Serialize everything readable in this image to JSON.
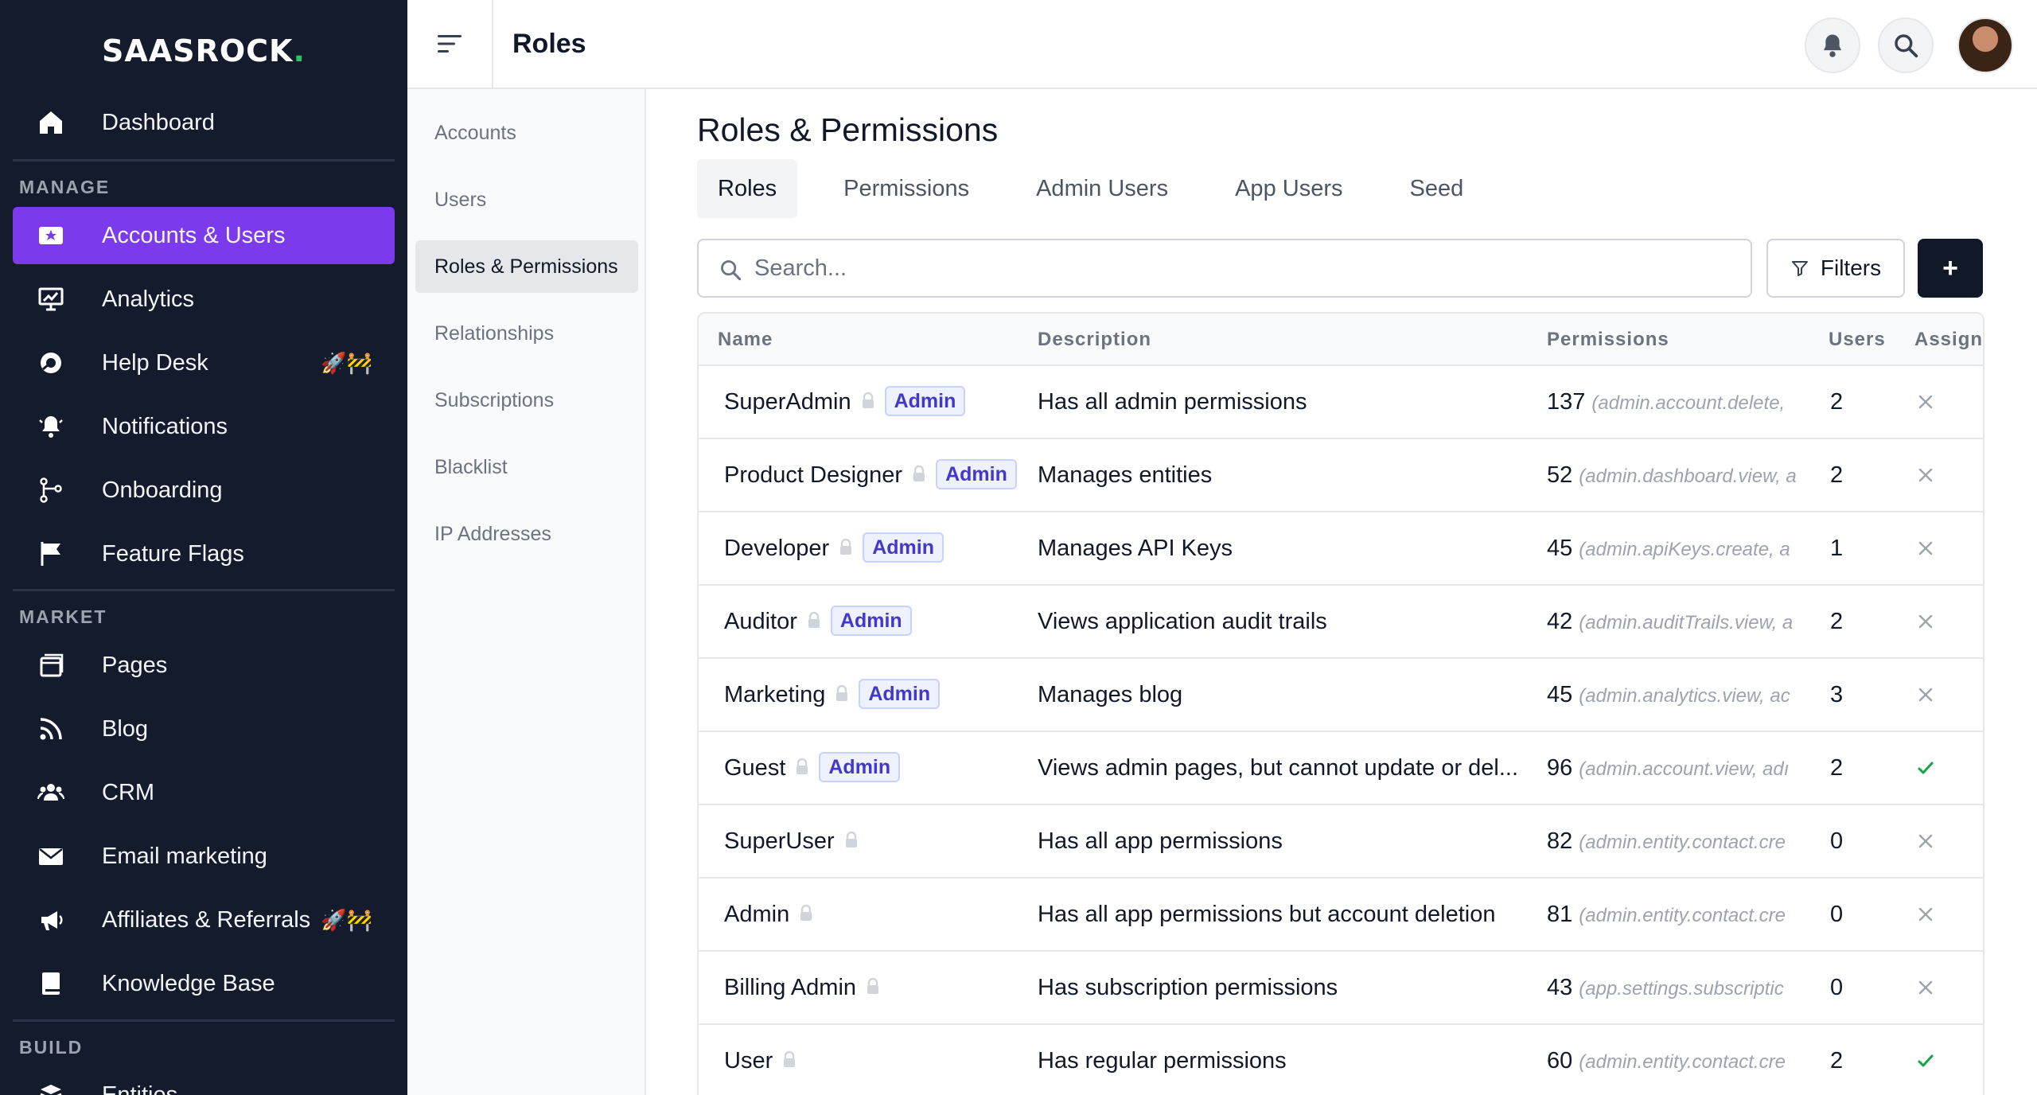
{
  "brand": {
    "name": "SAASROCK",
    "dot": "."
  },
  "sidebar": {
    "dashboard": {
      "label": "Dashboard",
      "icon": "home-icon"
    },
    "sections": [
      {
        "title": "MANAGE",
        "items": [
          {
            "label": "Accounts & Users",
            "icon": "accounts-icon",
            "active": true,
            "emoji": ""
          },
          {
            "label": "Analytics",
            "icon": "analytics-icon",
            "active": false,
            "emoji": ""
          },
          {
            "label": "Help Desk",
            "icon": "help-desk-icon",
            "active": false,
            "emoji": "🚀🚧"
          },
          {
            "label": "Notifications",
            "icon": "notifications-icon",
            "active": false,
            "emoji": ""
          },
          {
            "label": "Onboarding",
            "icon": "onboarding-icon",
            "active": false,
            "emoji": ""
          },
          {
            "label": "Feature Flags",
            "icon": "flag-icon",
            "active": false,
            "emoji": ""
          }
        ]
      },
      {
        "title": "MARKET",
        "items": [
          {
            "label": "Pages",
            "icon": "pages-icon",
            "active": false,
            "emoji": ""
          },
          {
            "label": "Blog",
            "icon": "rss-icon",
            "active": false,
            "emoji": ""
          },
          {
            "label": "CRM",
            "icon": "crm-icon",
            "active": false,
            "emoji": ""
          },
          {
            "label": "Email marketing",
            "icon": "email-icon",
            "active": false,
            "emoji": ""
          },
          {
            "label": "Affiliates & Referrals",
            "icon": "affiliates-icon",
            "active": false,
            "emoji": "🚀🚧"
          },
          {
            "label": "Knowledge Base",
            "icon": "book-icon",
            "active": false,
            "emoji": ""
          }
        ]
      },
      {
        "title": "BUILD",
        "items": [
          {
            "label": "Entities",
            "icon": "entities-icon",
            "active": false,
            "emoji": ""
          }
        ]
      }
    ]
  },
  "header": {
    "title": "Roles"
  },
  "subnav": [
    {
      "label": "Accounts",
      "active": false
    },
    {
      "label": "Users",
      "active": false
    },
    {
      "label": "Roles & Permissions",
      "active": true
    },
    {
      "label": "Relationships",
      "active": false
    },
    {
      "label": "Subscriptions",
      "active": false
    },
    {
      "label": "Blacklist",
      "active": false
    },
    {
      "label": "IP Addresses",
      "active": false
    }
  ],
  "main": {
    "title": "Roles & Permissions",
    "tabs": [
      {
        "label": "Roles",
        "active": true
      },
      {
        "label": "Permissions",
        "active": false
      },
      {
        "label": "Admin Users",
        "active": false
      },
      {
        "label": "App Users",
        "active": false
      },
      {
        "label": "Seed",
        "active": false
      }
    ],
    "search": {
      "placeholder": "Search...",
      "value": ""
    },
    "filters_label": "Filters",
    "add_label": "+"
  },
  "table": {
    "columns": [
      "Name",
      "Description",
      "Permissions",
      "Users",
      "Assign"
    ],
    "rows": [
      {
        "name": "SuperAdmin",
        "badge": "Admin",
        "description": "Has all admin permissions",
        "perm_count": "137",
        "perm_list": "(admin.account.delete,",
        "users": "2",
        "assigned": false
      },
      {
        "name": "Product Designer",
        "badge": "Admin",
        "description": "Manages entities",
        "perm_count": "52",
        "perm_list": "(admin.dashboard.view, a",
        "users": "2",
        "assigned": false
      },
      {
        "name": "Developer",
        "badge": "Admin",
        "description": "Manages API Keys",
        "perm_count": "45",
        "perm_list": "(admin.apiKeys.create, a",
        "users": "1",
        "assigned": false
      },
      {
        "name": "Auditor",
        "badge": "Admin",
        "description": "Views application audit trails",
        "perm_count": "42",
        "perm_list": "(admin.auditTrails.view, a",
        "users": "2",
        "assigned": false
      },
      {
        "name": "Marketing",
        "badge": "Admin",
        "description": "Manages blog",
        "perm_count": "45",
        "perm_list": "(admin.analytics.view, ac",
        "users": "3",
        "assigned": false
      },
      {
        "name": "Guest",
        "badge": "Admin",
        "description": "Views admin pages, but cannot update or del...",
        "perm_count": "96",
        "perm_list": "(admin.account.view, adı",
        "users": "2",
        "assigned": true
      },
      {
        "name": "SuperUser",
        "badge": "",
        "description": "Has all app permissions",
        "perm_count": "82",
        "perm_list": "(admin.entity.contact.cre",
        "users": "0",
        "assigned": false
      },
      {
        "name": "Admin",
        "badge": "",
        "description": "Has all app permissions but account deletion",
        "perm_count": "81",
        "perm_list": "(admin.entity.contact.cre",
        "users": "0",
        "assigned": false
      },
      {
        "name": "Billing Admin",
        "badge": "",
        "description": "Has subscription permissions",
        "perm_count": "43",
        "perm_list": "(app.settings.subscriptic",
        "users": "0",
        "assigned": false
      },
      {
        "name": "User",
        "badge": "",
        "description": "Has regular permissions",
        "perm_count": "60",
        "perm_list": "(admin.entity.contact.cre",
        "users": "2",
        "assigned": true
      }
    ]
  },
  "colors": {
    "sidebar_bg": "#141b2d",
    "accent": "#7c3aed",
    "brand_dot": "#22c55e",
    "check": "#16a34a",
    "badge": "#4338ca"
  }
}
